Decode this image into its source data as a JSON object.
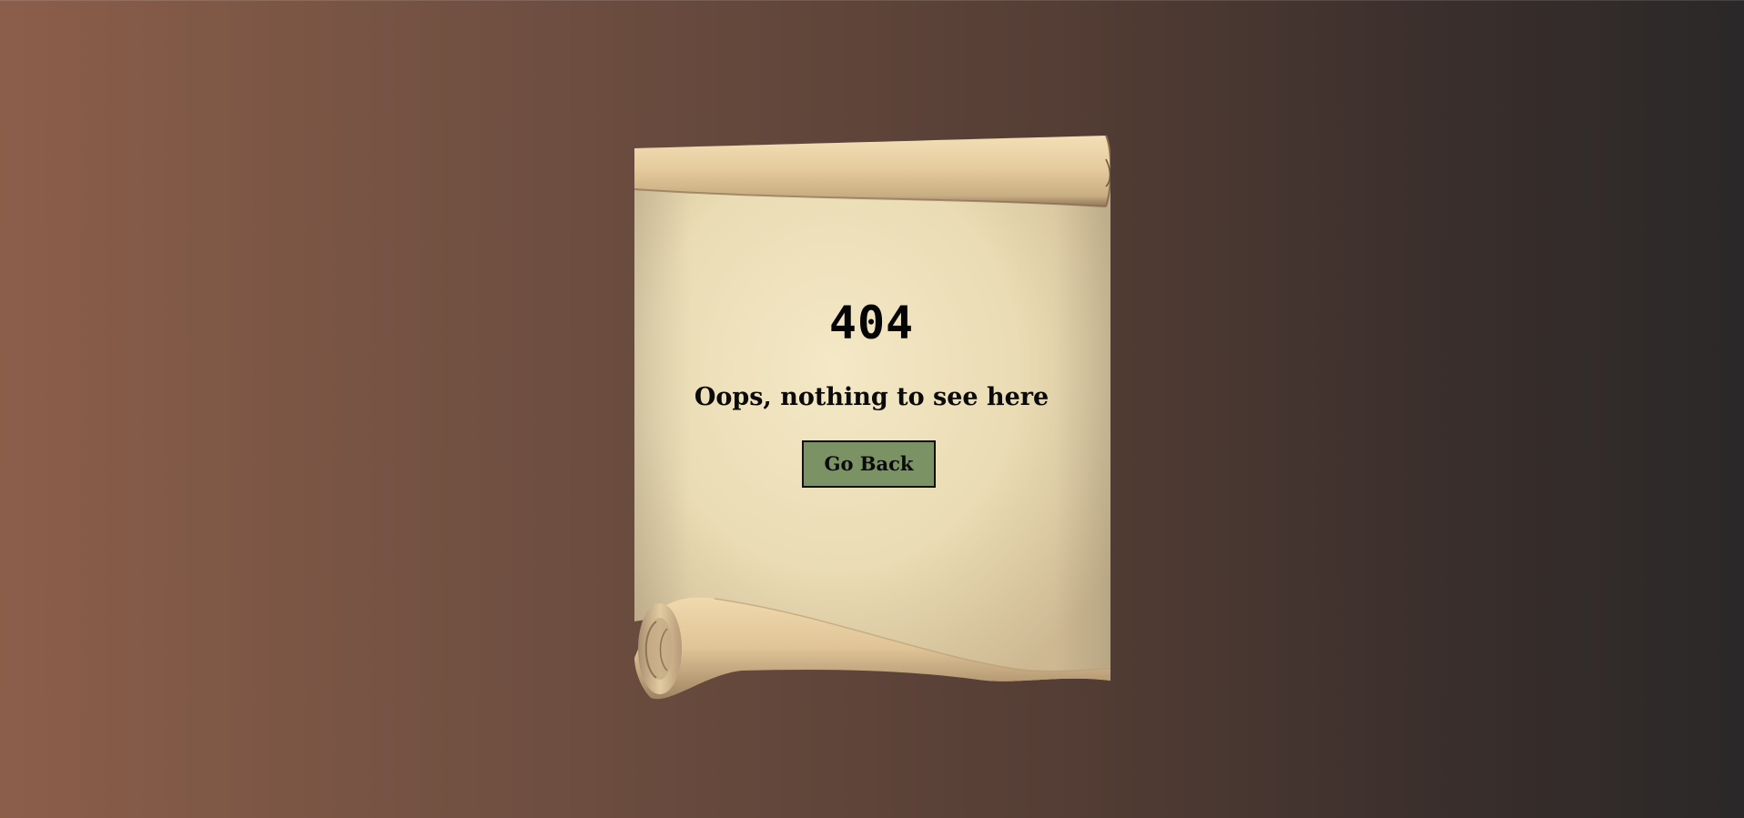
{
  "colors": {
    "background_left": "#8b5e4a",
    "background_right": "#2a2828",
    "parchment": "#f2e6c4",
    "button_fill": "#7a9264",
    "text": "#050505"
  },
  "error": {
    "code": "404",
    "message": "Oops, nothing to see here"
  },
  "actions": {
    "go_back_label": "Go Back"
  },
  "icons": {
    "scroll": "parchment-scroll-icon"
  }
}
